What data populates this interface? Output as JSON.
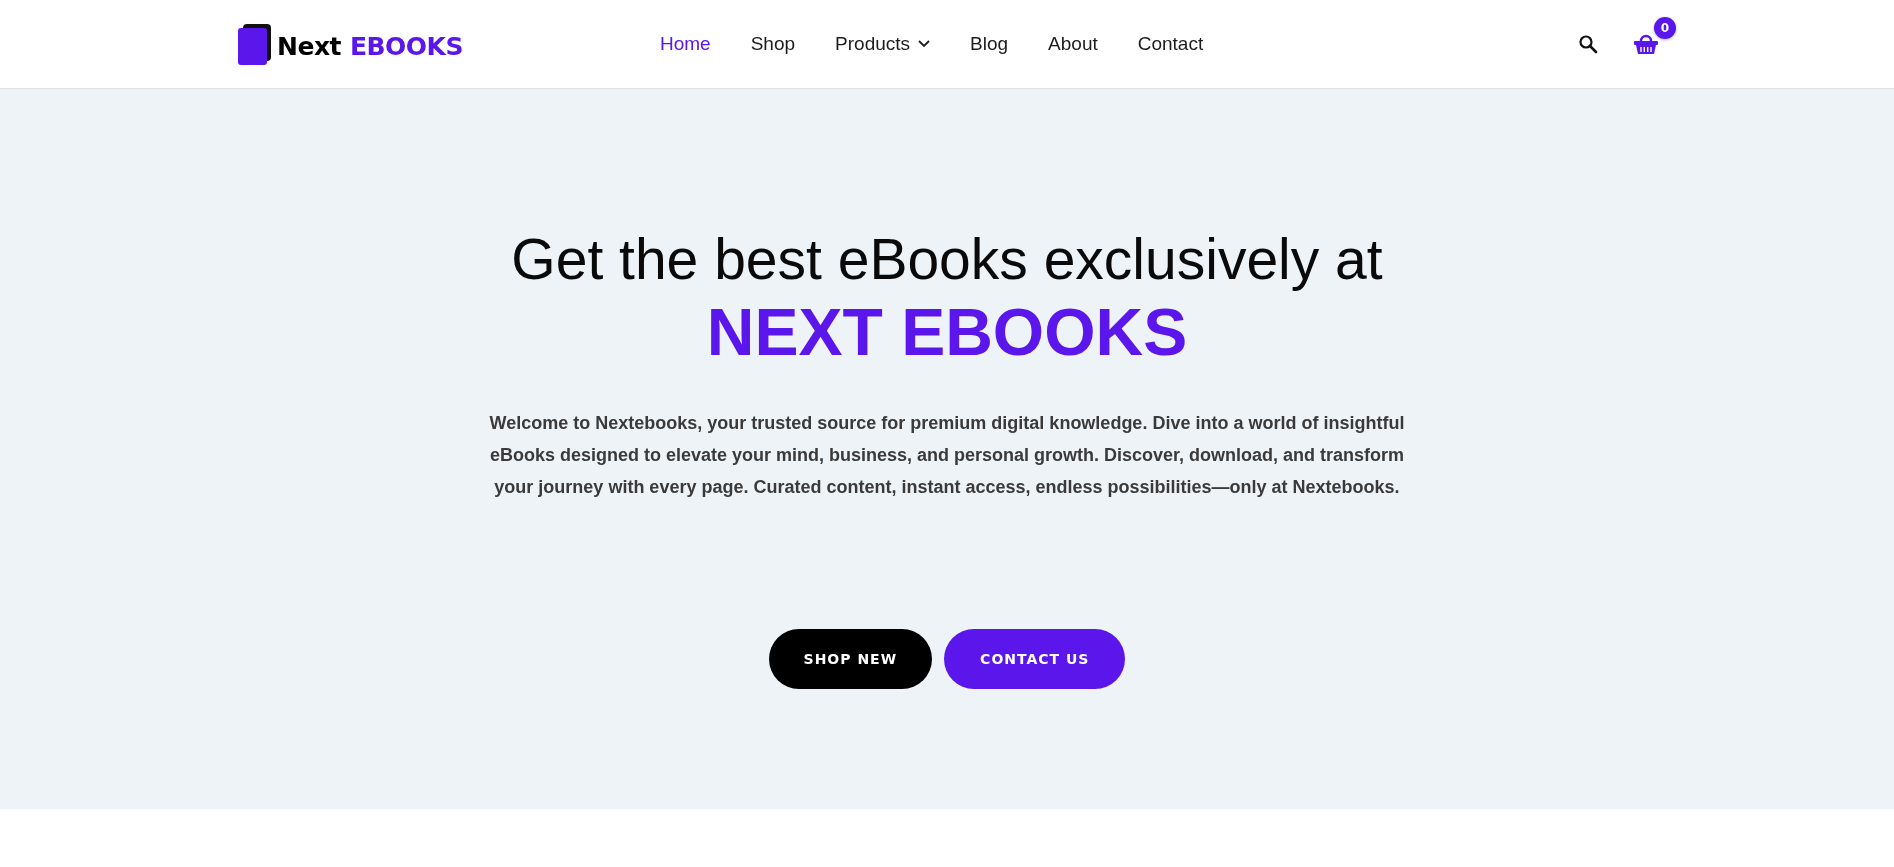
{
  "logo": {
    "first": "Next",
    "second": "EBOOKS"
  },
  "nav": [
    {
      "label": "Home",
      "selected": true,
      "submenu": false
    },
    {
      "label": "Shop",
      "selected": false,
      "submenu": false
    },
    {
      "label": "Products",
      "selected": false,
      "submenu": true
    },
    {
      "label": "Blog",
      "selected": false,
      "submenu": false
    },
    {
      "label": "About",
      "selected": false,
      "submenu": false
    },
    {
      "label": "Contact",
      "selected": false,
      "submenu": false
    }
  ],
  "cart": {
    "count": "0"
  },
  "hero": {
    "heading": "Get the best eBooks exclusively at",
    "brand": "NEXT EBOOKS",
    "text": "Welcome to Nextebooks, your trusted source for premium digital knowledge. Dive into a world of insightful eBooks designed to elevate your mind, business, and personal growth. Discover, download, and transform your journey with every page. Curated content, instant access, endless possibilities—only at Nextebooks.",
    "buttons": [
      {
        "label": "SHOP NEW",
        "kind": "dark"
      },
      {
        "label": "CONTACT US",
        "kind": "accent"
      }
    ]
  }
}
